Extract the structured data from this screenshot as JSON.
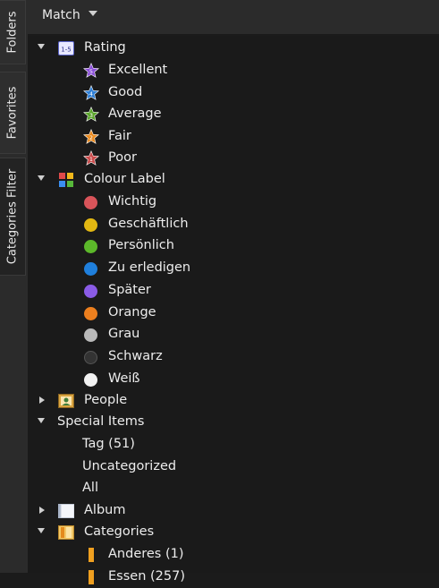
{
  "tabs": [
    "Folders",
    "Favorites",
    "Categories Filter"
  ],
  "header": {
    "match_label": "Match"
  },
  "tree": {
    "rating": {
      "label": "Rating",
      "icon_text": "1-5",
      "items": [
        {
          "label": "Excellent",
          "num": "5",
          "color": "#8b4fd8"
        },
        {
          "label": "Good",
          "num": "4",
          "color": "#2f7fd6"
        },
        {
          "label": "Average",
          "num": "3",
          "color": "#5aa42a"
        },
        {
          "label": "Fair",
          "num": "2",
          "color": "#e9891e"
        },
        {
          "label": "Poor",
          "num": "1",
          "color": "#c94a4a"
        }
      ]
    },
    "colour_label": {
      "label": "Colour Label",
      "items": [
        {
          "label": "Wichtig",
          "color": "#d9545a"
        },
        {
          "label": "Geschäftlich",
          "color": "#e3b812"
        },
        {
          "label": "Persönlich",
          "color": "#5cb82a"
        },
        {
          "label": "Zu erledigen",
          "color": "#1f7fdc"
        },
        {
          "label": "Später",
          "color": "#8a5be6"
        },
        {
          "label": "Orange",
          "color": "#ec7f1e"
        },
        {
          "label": "Grau",
          "color": "#b9b9b9"
        },
        {
          "label": "Schwarz",
          "color": "#333333"
        },
        {
          "label": "Weiß",
          "color": "#f2f2f2"
        }
      ]
    },
    "people": {
      "label": "People"
    },
    "special_items": {
      "label": "Special Items",
      "items": [
        "Tag (51)",
        "Uncategorized",
        "All"
      ]
    },
    "album": {
      "label": "Album"
    },
    "categories": {
      "label": "Categories",
      "items": [
        "Anderes (1)",
        "Essen (257)"
      ]
    }
  }
}
